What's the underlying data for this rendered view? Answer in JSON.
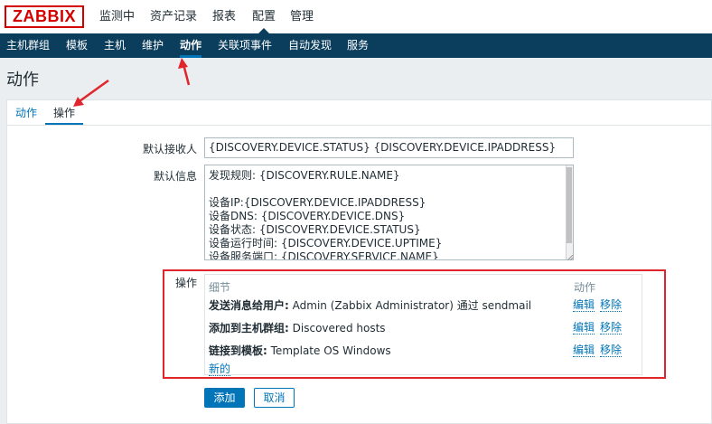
{
  "header": {
    "logo": "ZABBIX",
    "menu": [
      {
        "label": "监测中"
      },
      {
        "label": "资产记录"
      },
      {
        "label": "报表"
      },
      {
        "label": "配置",
        "active": true
      },
      {
        "label": "管理"
      }
    ]
  },
  "subnav": {
    "items": [
      {
        "label": "主机群组"
      },
      {
        "label": "模板"
      },
      {
        "label": "主机"
      },
      {
        "label": "维护"
      },
      {
        "label": "动作",
        "active": true
      },
      {
        "label": "关联项事件"
      },
      {
        "label": "自动发现"
      },
      {
        "label": "服务"
      }
    ]
  },
  "page": {
    "title": "动作",
    "tabs": [
      {
        "label": "动作"
      },
      {
        "label": "操作",
        "active": true
      }
    ]
  },
  "form": {
    "recipient_label": "默认接收人",
    "recipient_value": "{DISCOVERY.DEVICE.STATUS} {DISCOVERY.DEVICE.IPADDRESS}",
    "message_label": "默认信息",
    "message_lines": [
      "发现规则: {DISCOVERY.RULE.NAME}",
      "",
      "设备IP:{DISCOVERY.DEVICE.IPADDRESS}",
      "设备DNS: {DISCOVERY.DEVICE.DNS}",
      "设备状态: {DISCOVERY.DEVICE.STATUS}",
      "设备运行时间: {DISCOVERY.DEVICE.UPTIME}",
      "设备服务端口: {DISCOVERY.SERVICE.NAME}"
    ],
    "operations_label": "操作",
    "operations": {
      "col_detail": "细节",
      "col_action": "动作",
      "rows": [
        {
          "title": "发送消息给用户:",
          "detail": "Admin (Zabbix Administrator) 通过 sendmail",
          "edit": "编辑",
          "remove": "移除"
        },
        {
          "title": "添加到主机群组:",
          "detail": "Discovered hosts",
          "edit": "编辑",
          "remove": "移除"
        },
        {
          "title": "链接到模板:",
          "detail": "Template OS Windows",
          "edit": "编辑",
          "remove": "移除"
        }
      ],
      "new_link": "新的"
    },
    "add_button": "添加",
    "cancel_button": "取消"
  },
  "colors": {
    "brand_red": "#d40000",
    "nav_bg": "#0b3d5c",
    "link_blue": "#0275b8",
    "annotation_red": "#e0262c"
  }
}
